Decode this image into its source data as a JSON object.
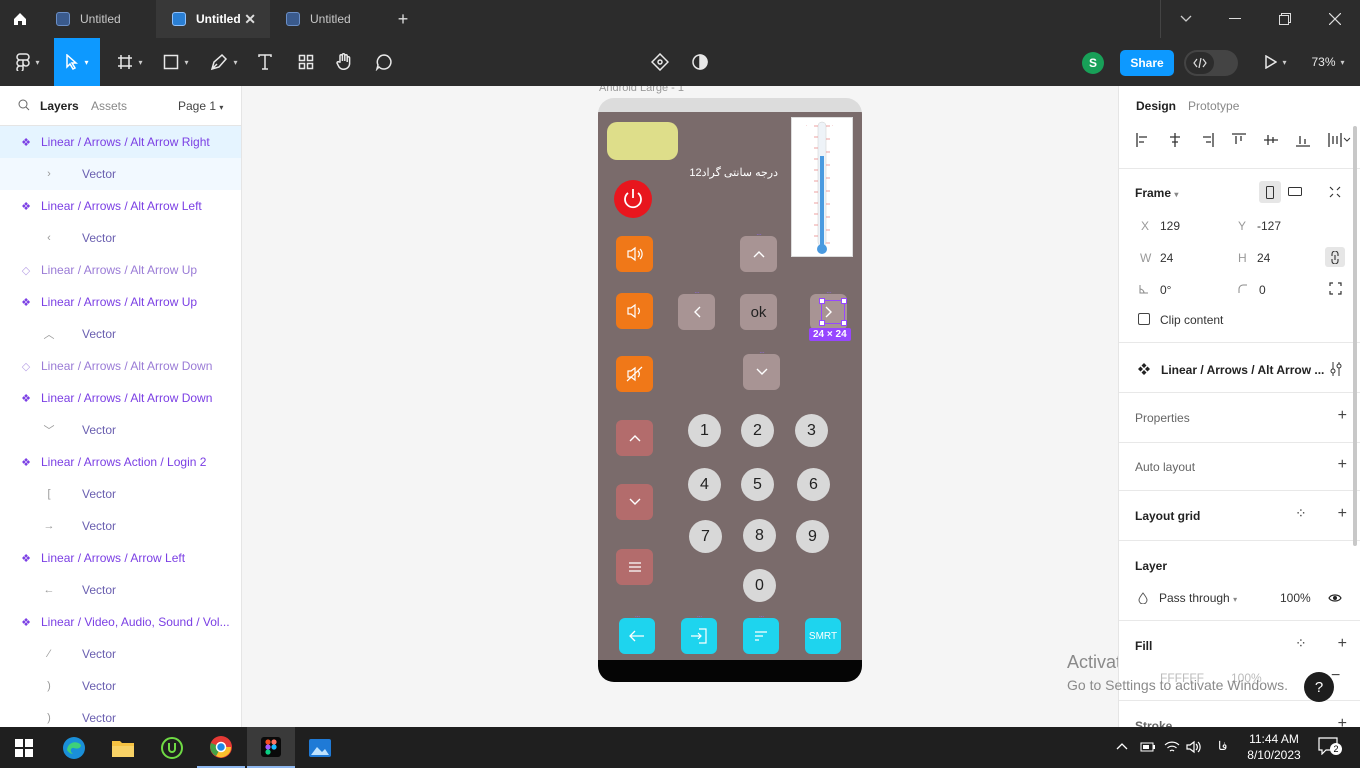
{
  "tabs": [
    {
      "label": "Untitled"
    },
    {
      "label": "Untitled"
    },
    {
      "label": "Untitled"
    }
  ],
  "toolbar": {
    "avatar_letter": "S",
    "share_label": "Share",
    "zoom": "73%"
  },
  "left_panel": {
    "tab_layers": "Layers",
    "tab_assets": "Assets",
    "page": "Page 1",
    "layers": [
      {
        "label": "Linear / Arrows / Alt Arrow Right",
        "kind": "component",
        "icon": "component-icon"
      },
      {
        "label": "Vector",
        "kind": "vector",
        "icon": "chevron-right-icon"
      },
      {
        "label": "Linear / Arrows / Alt Arrow Left",
        "kind": "component",
        "icon": "component-icon"
      },
      {
        "label": "Vector",
        "kind": "vector",
        "icon": "chevron-left-icon"
      },
      {
        "label": "Linear / Arrows / Alt Arrow Up",
        "kind": "instance",
        "icon": "instance-icon"
      },
      {
        "label": "Linear / Arrows / Alt Arrow Up",
        "kind": "component",
        "icon": "component-icon"
      },
      {
        "label": "Vector",
        "kind": "vector",
        "icon": "chevron-up-icon"
      },
      {
        "label": "Linear / Arrows / Alt Arrow Down",
        "kind": "instance",
        "icon": "instance-icon"
      },
      {
        "label": "Linear / Arrows / Alt Arrow Down",
        "kind": "component",
        "icon": "component-icon"
      },
      {
        "label": "Vector",
        "kind": "vector",
        "icon": "chevron-down-icon"
      },
      {
        "label": "Linear / Arrows Action / Login 2",
        "kind": "component",
        "icon": "component-icon"
      },
      {
        "label": "Vector",
        "kind": "vector",
        "icon": "bracket-icon"
      },
      {
        "label": "Vector",
        "kind": "vector",
        "icon": "arrow-right-icon"
      },
      {
        "label": "Linear / Arrows / Arrow Left",
        "kind": "component",
        "icon": "component-icon"
      },
      {
        "label": "Vector",
        "kind": "vector",
        "icon": "arrow-left-icon"
      },
      {
        "label": "Linear / Video, Audio, Sound / Vol...",
        "kind": "component",
        "icon": "component-icon"
      },
      {
        "label": "Vector",
        "kind": "vector",
        "icon": "slash-icon"
      },
      {
        "label": "Vector",
        "kind": "vector",
        "icon": "paren-icon"
      },
      {
        "label": "Vector",
        "kind": "vector",
        "icon": "paren-icon"
      }
    ]
  },
  "canvas": {
    "frame_label": "Android Large - 1",
    "temperature_text": "12درجه سانتی گراد",
    "ok_label": "ok",
    "smrt_label": "SMRT",
    "selection_size": "24 × 24",
    "numbers": [
      "1",
      "2",
      "3",
      "4",
      "5",
      "6",
      "7",
      "8",
      "9",
      "0"
    ],
    "colors": {
      "phone_body": "#7a6b6b",
      "accent_orange": "#f07818",
      "cyan": "#1ed4ee",
      "power_red": "#e8161e",
      "yellow_pill": "#dede8a",
      "selection": "#9747ff"
    }
  },
  "right_panel": {
    "tab_design": "Design",
    "tab_prototype": "Prototype",
    "frame_label": "Frame",
    "x_label": "X",
    "x_value": "129",
    "y_label": "Y",
    "y_value": "-127",
    "w_label": "W",
    "w_value": "24",
    "h_label": "H",
    "h_value": "24",
    "rotation": "0°",
    "radius": "0",
    "clip_content": "Clip content",
    "component_name": "Linear / Arrows / Alt Arrow ...",
    "properties": "Properties",
    "auto_layout": "Auto layout",
    "layout_grid": "Layout grid",
    "layer": "Layer",
    "blend": "Pass through",
    "opacity": "100%",
    "fill": "Fill",
    "fill_hex": "FFFFFF",
    "fill_opacity": "100%",
    "stroke": "Stroke"
  },
  "watermark": {
    "line1": "Activate Windows",
    "line2": "Go to Settings to activate Windows."
  },
  "help_label": "?",
  "taskbar": {
    "time": "11:44 AM",
    "date": "8/10/2023",
    "lang": "فا",
    "notif_count": "2"
  }
}
